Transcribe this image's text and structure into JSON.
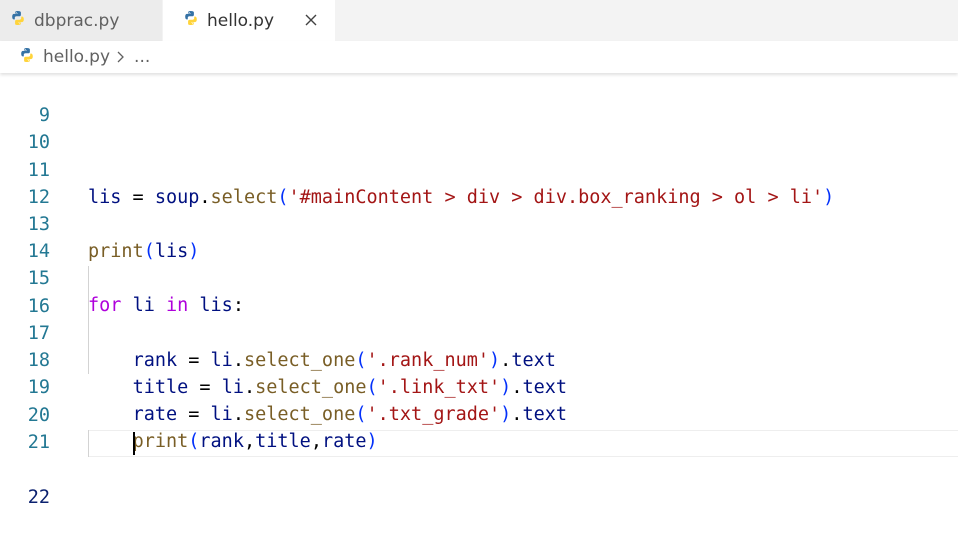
{
  "tabs": [
    {
      "label": "dbprac.py",
      "active": false,
      "icon": "python-icon"
    },
    {
      "label": "hello.py",
      "active": true,
      "icon": "python-icon",
      "close_icon": "close-icon"
    }
  ],
  "breadcrumb": {
    "file": "hello.py",
    "separator_icon": "chevron-right-icon",
    "more": "..."
  },
  "editor": {
    "current_line": "22",
    "lines": [
      {
        "num": "9"
      },
      {
        "num": "10"
      },
      {
        "num": "11",
        "t": [
          "lis",
          " = ",
          "soup",
          ".",
          "select",
          "(",
          "'#mainContent > div > div.box_ranking > ol > li'",
          ")"
        ]
      },
      {
        "num": "12"
      },
      {
        "num": "13",
        "t": [
          "print",
          "(",
          "lis",
          ")"
        ]
      },
      {
        "num": "14"
      },
      {
        "num": "15",
        "t": [
          "for",
          " ",
          "li",
          " ",
          "in",
          " ",
          "lis",
          ":"
        ]
      },
      {
        "num": "16",
        "t": [
          "    ",
          "rank",
          " = ",
          "li",
          ".",
          "select_one",
          "(",
          "'.rank_num'",
          ")",
          ".",
          "text"
        ]
      },
      {
        "num": "17",
        "t": [
          "    ",
          "title",
          " = ",
          "li",
          ".",
          "select_one",
          "(",
          "'.link_txt'",
          ")",
          ".",
          "text"
        ]
      },
      {
        "num": "18",
        "t": [
          "    ",
          "rate",
          " = ",
          "li",
          ".",
          "select_one",
          "(",
          "'.txt_grade'",
          ")",
          ".",
          "text"
        ]
      },
      {
        "num": "19",
        "t": [
          "    ",
          "print",
          "(",
          "rank",
          ",",
          "title",
          ",",
          "rate",
          ")"
        ]
      },
      {
        "num": "20"
      },
      {
        "num": "21"
      },
      {
        "num": "22"
      }
    ]
  },
  "colors": {
    "line_number": "#237893",
    "variable": "#001080",
    "function": "#795e26",
    "string": "#a31515",
    "keyword": "#af00db",
    "bracket_level1": "#0431fa",
    "bracket_level2": "#319331",
    "python_blue": "#3572a5",
    "python_yellow": "#ffd43b"
  }
}
